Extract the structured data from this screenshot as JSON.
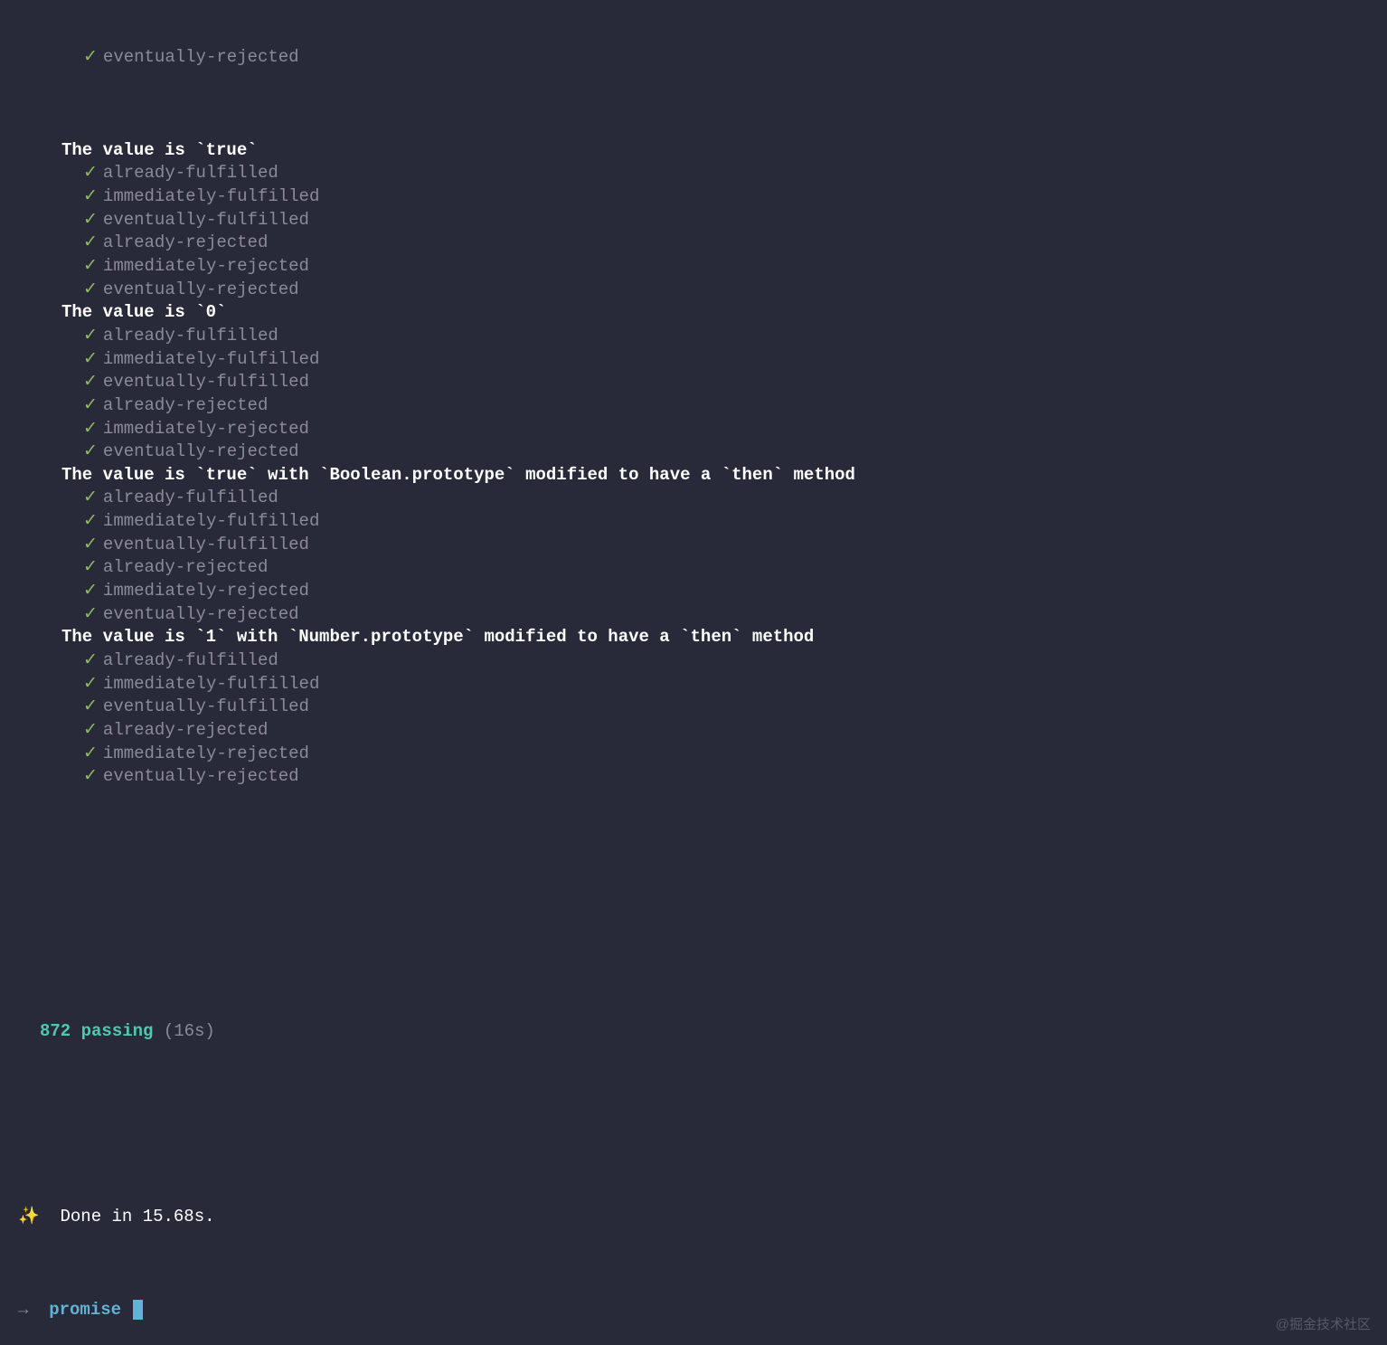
{
  "orphan_test": "eventually-rejected",
  "groups": [
    {
      "header": "The value is `true`",
      "tests": [
        "already-fulfilled",
        "immediately-fulfilled",
        "eventually-fulfilled",
        "already-rejected",
        "immediately-rejected",
        "eventually-rejected"
      ]
    },
    {
      "header": "The value is `0`",
      "tests": [
        "already-fulfilled",
        "immediately-fulfilled",
        "eventually-fulfilled",
        "already-rejected",
        "immediately-rejected",
        "eventually-rejected"
      ]
    },
    {
      "header": "The value is `true` with `Boolean.prototype` modified to have a `then` method",
      "tests": [
        "already-fulfilled",
        "immediately-fulfilled",
        "eventually-fulfilled",
        "already-rejected",
        "immediately-rejected",
        "eventually-rejected"
      ]
    },
    {
      "header": "The value is `1` with `Number.prototype` modified to have a `then` method",
      "tests": [
        "already-fulfilled",
        "immediately-fulfilled",
        "eventually-fulfilled",
        "already-rejected",
        "immediately-rejected",
        "eventually-rejected"
      ]
    }
  ],
  "summary": {
    "passing_count": "872 passing",
    "duration": "(16s)"
  },
  "done": {
    "sparkle": "✨",
    "text": "Done in 15.68s."
  },
  "prompt": {
    "arrow": "→",
    "word": "promise"
  },
  "watermark": "@掘金技术社区"
}
